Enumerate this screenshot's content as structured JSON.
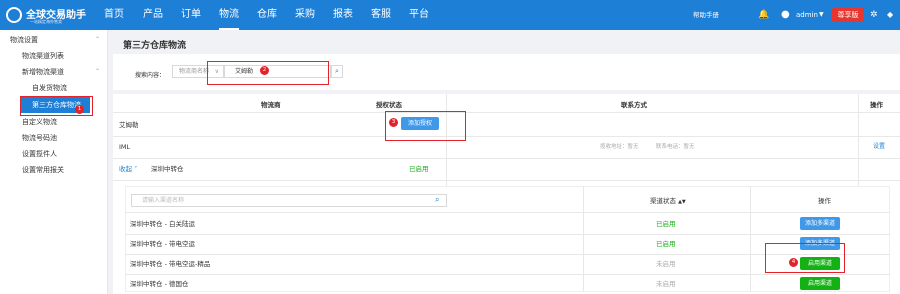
{
  "header": {
    "logo_name": "全球交易助手",
    "logo_slogan": "一站搞定海外售卖",
    "nav": [
      "首页",
      "产品",
      "订单",
      "物流",
      "仓库",
      "采购",
      "报表",
      "客服",
      "平台"
    ],
    "help": "帮助手册",
    "user": "admin",
    "vip": "尊享版",
    "accent": "#1e7fd7"
  },
  "sidebar": {
    "items": [
      {
        "label": "物流设置",
        "arrow": "^"
      },
      {
        "label": "物流渠道列表"
      },
      {
        "label": "新增物流渠道",
        "arrow": "^"
      },
      {
        "label": "自发货物流"
      },
      {
        "label": "第三方仓库物流"
      },
      {
        "label": "自定义物流"
      },
      {
        "label": "物流号码池"
      },
      {
        "label": "设置揽件人"
      },
      {
        "label": "设置常用报关"
      }
    ]
  },
  "page": {
    "title": "第三方仓库物流",
    "search_label": "搜索内容：",
    "search_field": "物流商名称",
    "search_value": "艾姆勒",
    "columns": [
      "物流商",
      "授权状态",
      "联系方式",
      "操作"
    ]
  },
  "rows": {
    "provider1": "艾姆勒",
    "authorize_btn": "添加授权",
    "provider2": "IML",
    "address": "揽收地址：暂无",
    "phone": "联系电话：暂无",
    "settings": "设置",
    "collapse": "收起",
    "warehouse": "深圳中转仓",
    "enabled": "已启用"
  },
  "subtable": {
    "placeholder": "请输入渠道名称",
    "col_status": "渠道状态",
    "col_action": "操作",
    "rows": [
      {
        "name": "深圳中转仓 - 白关陆运",
        "status": "已启用",
        "action": "添加多渠道",
        "state": "on"
      },
      {
        "name": "深圳中转仓 - 带电空运",
        "status": "已启用",
        "action": "添加多渠道",
        "state": "on"
      },
      {
        "name": "深圳中转仓 - 带电空运-精品",
        "status": "未启用",
        "action": "启用渠道",
        "state": "off"
      },
      {
        "name": "深圳中转仓 - 德国仓",
        "status": "未启用",
        "action": "启用渠道",
        "state": "off"
      }
    ]
  },
  "annotations": [
    "1",
    "2",
    "3",
    "4"
  ]
}
